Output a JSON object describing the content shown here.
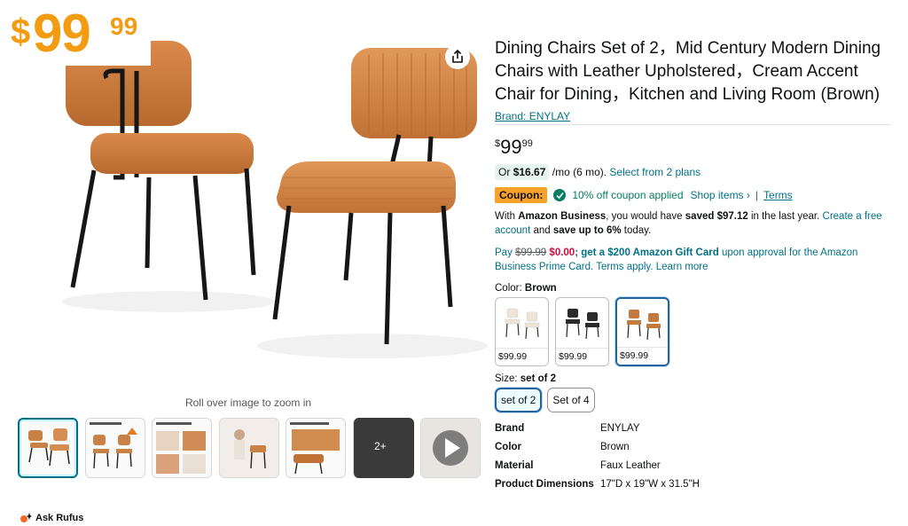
{
  "image_overlay": {
    "currency": "$",
    "whole": "99",
    "fraction": "99"
  },
  "gallery": {
    "zoom_hint": "Roll over image to zoom in",
    "more_count": "2+",
    "share_icon": "share-icon",
    "thumbnails": [
      "product-photo",
      "product-dimensions",
      "product-features",
      "lifestyle-photo",
      "product-details",
      "product-features-2",
      "more-photos",
      "video"
    ]
  },
  "rufus": {
    "label": "Ask Rufus"
  },
  "product": {
    "title": "Dining Chairs Set of 2，Mid Century Modern Dining Chairs with Leather Upholstered，Cream Accent Chair for Dining，Kitchen and Living Room (Brown)",
    "brand_link": "Brand: ENYLAY"
  },
  "price": {
    "currency": "$",
    "whole": "99",
    "fraction": "99"
  },
  "monthly": {
    "prefix": "Or",
    "amount": "$16.67",
    "suffix": "/mo (6 mo).",
    "link": "Select from 2 plans"
  },
  "coupon": {
    "badge": "Coupon:",
    "text": "10% off coupon applied",
    "shop_link": "Shop items ›",
    "separator": "|",
    "terms_link": "Terms"
  },
  "business": {
    "t1": "With",
    "name": "Amazon Business",
    "t2": ", you would have",
    "saved": "saved $97.12",
    "t3": "in the last year.",
    "link": "Create a free account",
    "t4": "and",
    "save_up": "save up to 6%",
    "t5": "today."
  },
  "gift": {
    "t1": "Pay",
    "old_price": "$99.99",
    "new_price": "$0.00",
    "t2": "; get a $200 Amazon Gift Card",
    "t3": "upon approval for the Amazon Business Prime Card. Terms apply. Learn more"
  },
  "color": {
    "label": "Color:",
    "selected": "Brown",
    "options": [
      {
        "price": "$99.99",
        "tone": "#ece5d6",
        "frame": "#333333"
      },
      {
        "price": "$99.99",
        "tone": "#2b2b2b",
        "frame": "#222222"
      },
      {
        "price": "$99.99",
        "tone": "#c47a3f",
        "frame": "#222222"
      }
    ]
  },
  "size": {
    "label": "Size:",
    "selected": "set of 2",
    "options": [
      "set of 2",
      "Set of 4"
    ]
  },
  "specs": [
    {
      "key": "Brand",
      "value": "ENYLAY"
    },
    {
      "key": "Color",
      "value": "Brown"
    },
    {
      "key": "Material",
      "value": "Faux Leather"
    },
    {
      "key": "Product Dimensions",
      "value": "17\"D x 19\"W x 31.5\"H"
    }
  ],
  "colors": {
    "price_orange": "#f39c12",
    "link": "#007185",
    "coupon_green": "#067d62",
    "coupon_badge": "#f7a22a",
    "selection_blue": "#2162a1"
  }
}
